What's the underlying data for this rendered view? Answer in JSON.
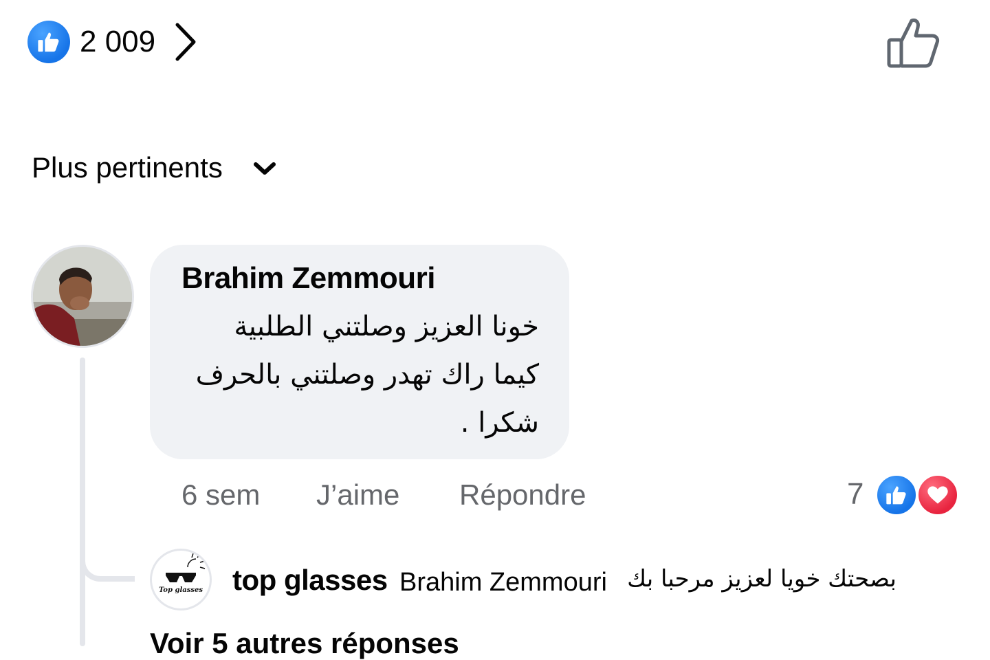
{
  "reactions_summary": {
    "icon": "thumbs-up-icon",
    "count": "2 009",
    "chevron_icon": "chevron-right-icon",
    "like_action_icon": "thumbs-up-outline-icon",
    "accent_color": "#1674e8"
  },
  "sort": {
    "label": "Plus pertinents",
    "icon": "chevron-down-icon"
  },
  "comment": {
    "author": "Brahim Zemmouri",
    "text_lines": [
      "خونا العزيز وصلتني الطلبية",
      "كيما راك تهدر وصلتني بالحرف",
      "شكرا ."
    ],
    "time": "6 sem",
    "like_label": "J’aime",
    "reply_label": "Répondre",
    "reaction_count": "7",
    "reaction_icons": [
      "thumbs-up-icon",
      "heart-icon"
    ],
    "love_color": "#e8243f"
  },
  "reply": {
    "author": "top glasses",
    "avatar_logo_text": "Top glasses",
    "mention": "Brahim Zemmouri",
    "text": "بصحتك خويا لعزيز مرحبا بك"
  },
  "more_replies_label": "Voir 5 autres réponses"
}
